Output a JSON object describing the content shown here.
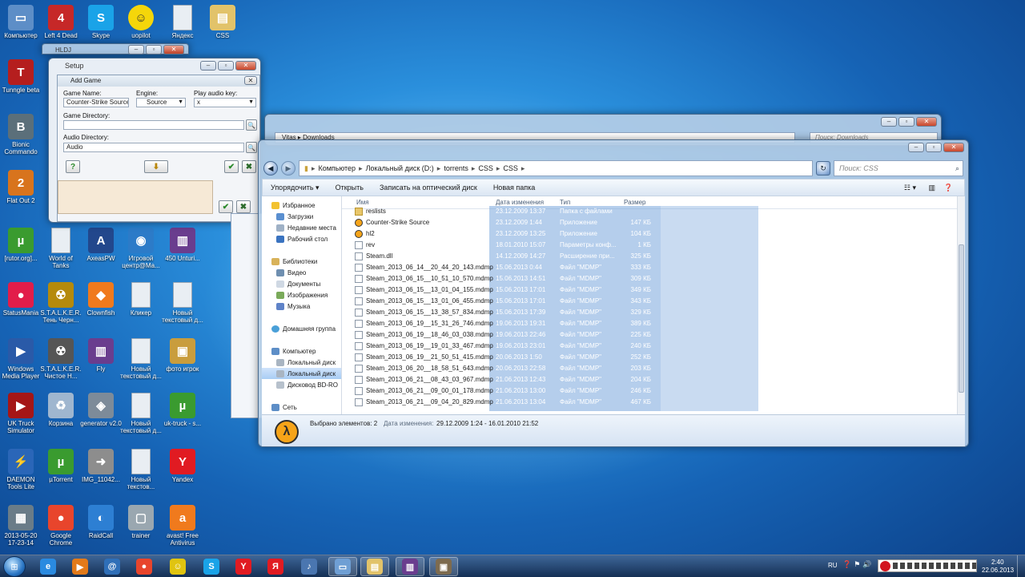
{
  "desktop": {
    "icons": [
      {
        "label": "Компьютер",
        "icon": "computer-icon",
        "color": "#5d8ec7"
      },
      {
        "label": "Left 4 Dead",
        "icon": "left4dead-icon",
        "color": "#c62828"
      },
      {
        "label": "Skype",
        "icon": "skype-icon",
        "color": "#1aa3e8"
      },
      {
        "label": "uopilot",
        "icon": "smiley-icon",
        "color": "#f5d60a"
      },
      {
        "label": "Яндекс",
        "icon": "document-icon",
        "color": "#e9eef3"
      },
      {
        "label": "CSS",
        "icon": "folder-icon",
        "color": "#e2c36a"
      },
      {
        "label": "Tunngle beta",
        "icon": "tunngle-icon",
        "color": "#b51e1e"
      },
      {
        "label": "Bionic Commando",
        "icon": "bionic-commando-icon",
        "color": "#5b6f7a"
      },
      {
        "label": "Flat Out 2",
        "icon": "flatout-icon",
        "color": "#d8741d"
      },
      {
        "label": "[rutor.org]...",
        "icon": "utorrent-icon",
        "color": "#3a9b2f"
      },
      {
        "label": "World of Tanks",
        "icon": "document-icon",
        "color": "#e9eef3"
      },
      {
        "label": "AxeasPW",
        "icon": "axeas-icon",
        "color": "#22478c"
      },
      {
        "label": "Игровой центр@Ма...",
        "icon": "game-center-icon",
        "color": "#2c7bc8"
      },
      {
        "label": "450 Unturi...",
        "icon": "winrar-icon",
        "color": "#6a3d8e"
      },
      {
        "label": "StatusMania",
        "icon": "statusmania-icon",
        "color": "#e21d4a"
      },
      {
        "label": "S.T.A.L.K.E.R. Тень Черн...",
        "icon": "stalker-icon",
        "color": "#b58a0c"
      },
      {
        "label": "Clownfish",
        "icon": "clownfish-icon",
        "color": "#f07a1d"
      },
      {
        "label": "Кликер",
        "icon": "document-icon",
        "color": "#e9eef3"
      },
      {
        "label": "Новый текстовый д...",
        "icon": "document-icon",
        "color": "#e9eef3"
      },
      {
        "label": "Windows Media Player",
        "icon": "media-player-icon",
        "color": "#2a5aa8"
      },
      {
        "label": "S.T.A.L.K.E.R. Чистое Н...",
        "icon": "stalker-icon",
        "color": "#555555"
      },
      {
        "label": "Fly",
        "icon": "winrar-icon",
        "color": "#6a3d8e"
      },
      {
        "label": "Новый текстовый д...",
        "icon": "document-icon",
        "color": "#e9eef3"
      },
      {
        "label": "фото игрок",
        "icon": "photo-folder-icon",
        "color": "#c99d3d"
      },
      {
        "label": "UK Truck Simulator",
        "icon": "truck-icon",
        "color": "#a51616"
      },
      {
        "label": "Корзина",
        "icon": "recycle-bin-icon",
        "color": "#9fb6cf"
      },
      {
        "label": "generator v2.0",
        "icon": "generator-icon",
        "color": "#7d8b99"
      },
      {
        "label": "Новый текстовый д...",
        "icon": "document-icon",
        "color": "#e9eef3"
      },
      {
        "label": "uk-truck - s...",
        "icon": "utorrent-icon",
        "color": "#3a9b2f"
      },
      {
        "label": "DAEMON Tools Lite",
        "icon": "daemon-tools-icon",
        "color": "#2a66b8"
      },
      {
        "label": "µTorrent",
        "icon": "utorrent-icon",
        "color": "#3a9b2f"
      },
      {
        "label": "IMG_11042...",
        "icon": "shortcut-arrow-icon",
        "color": "#8d8d8d"
      },
      {
        "label": "Новый текстов...",
        "icon": "document-icon",
        "color": "#e9eef3"
      },
      {
        "label": "Yandex",
        "icon": "yandex-icon",
        "color": "#e11b22"
      },
      {
        "label": "2013-05-20 17-23-14",
        "icon": "screenshot-icon",
        "color": "#6a7c88"
      },
      {
        "label": "Google Chrome",
        "icon": "chrome-icon",
        "color": "#e8452c"
      },
      {
        "label": "RaidCall",
        "icon": "raidcall-icon",
        "color": "#2d7fd3"
      },
      {
        "label": "trainer",
        "icon": "trainer-icon",
        "color": "#9aa7b0"
      },
      {
        "label": "avast! Free Antivirus",
        "icon": "avast-icon",
        "color": "#f07a1d"
      }
    ]
  },
  "hldj": {
    "title": "HLDJ",
    "setup_title": "Setup",
    "add_game_title": "Add Game",
    "game_name_label": "Game Name:",
    "game_name_value": "Counter-Strike Source",
    "engine_label": "Engine:",
    "engine_value": "Source",
    "play_key_label": "Play audio key:",
    "play_key_value": "x",
    "game_dir_label": "Game Directory:",
    "audio_dir_label": "Audio Directory:",
    "audio_dir_value": "Audio",
    "help_glyph": "?",
    "ok_glyph": "✔",
    "cancel_glyph": "✖",
    "down_glyph": "⬇"
  },
  "downloads_window": {
    "path": [
      "Vitas",
      "Downloads"
    ],
    "search_placeholder": "Поиск: Downloads"
  },
  "explorer": {
    "breadcrumbs": [
      "Компьютер",
      "Локальный диск (D:)",
      "torrents",
      "CSS",
      "CSS"
    ],
    "search_placeholder": "Поиск: CSS",
    "toolbar": [
      "Упорядочить ▾",
      "Открыть",
      "Записать на оптический диск",
      "Новая папка"
    ],
    "nav": {
      "favorites": "Избранное",
      "fav_items": [
        "Загрузки",
        "Недавние места",
        "Рабочий стол"
      ],
      "libraries": "Библиотеки",
      "lib_items": [
        "Видео",
        "Документы",
        "Изображения",
        "Музыка"
      ],
      "homegroup": "Домашняя группа",
      "computer": "Компьютер",
      "comp_items": [
        "Локальный диск",
        "Локальный диск",
        "Дисковод BD-RO"
      ],
      "network": "Сеть"
    },
    "columns": {
      "name": "Имя",
      "date": "Дата изменения",
      "type": "Тип",
      "size": "Размер"
    },
    "files": [
      {
        "name": "reslists",
        "date": "23.12.2009 13:37",
        "type": "Папка с файлами",
        "size": "",
        "kind": "folder"
      },
      {
        "name": "Counter-Strike Source",
        "date": "23.12.2009 1:44",
        "type": "Приложение",
        "size": "147 КБ",
        "kind": "app"
      },
      {
        "name": "hl2",
        "date": "23.12.2009 13:25",
        "type": "Приложение",
        "size": "104 КБ",
        "kind": "app"
      },
      {
        "name": "rev",
        "date": "18.01.2010 15:07",
        "type": "Параметры конф...",
        "size": "1 КБ",
        "kind": "file"
      },
      {
        "name": "Steam.dll",
        "date": "14.12.2009 14:27",
        "type": "Расширение при...",
        "size": "325 КБ",
        "kind": "file"
      },
      {
        "name": "Steam_2013_06_14__20_44_20_143.mdmp",
        "date": "15.06.2013 0:44",
        "type": "Файл \"MDMP\"",
        "size": "333 КБ",
        "kind": "file"
      },
      {
        "name": "Steam_2013_06_15__10_51_10_570.mdmp",
        "date": "15.06.2013 14:51",
        "type": "Файл \"MDMP\"",
        "size": "309 КБ",
        "kind": "file"
      },
      {
        "name": "Steam_2013_06_15__13_01_04_155.mdmp",
        "date": "15.06.2013 17:01",
        "type": "Файл \"MDMP\"",
        "size": "349 КБ",
        "kind": "file"
      },
      {
        "name": "Steam_2013_06_15__13_01_06_455.mdmp",
        "date": "15.06.2013 17:01",
        "type": "Файл \"MDMP\"",
        "size": "343 КБ",
        "kind": "file"
      },
      {
        "name": "Steam_2013_06_15__13_38_57_834.mdmp",
        "date": "15.06.2013 17:39",
        "type": "Файл \"MDMP\"",
        "size": "329 КБ",
        "kind": "file"
      },
      {
        "name": "Steam_2013_06_19__15_31_26_746.mdmp",
        "date": "19.06.2013 19:31",
        "type": "Файл \"MDMP\"",
        "size": "389 КБ",
        "kind": "file"
      },
      {
        "name": "Steam_2013_06_19__18_46_03_038.mdmp",
        "date": "19.06.2013 22:46",
        "type": "Файл \"MDMP\"",
        "size": "225 КБ",
        "kind": "file"
      },
      {
        "name": "Steam_2013_06_19__19_01_33_467.mdmp",
        "date": "19.06.2013 23:01",
        "type": "Файл \"MDMP\"",
        "size": "240 КБ",
        "kind": "file"
      },
      {
        "name": "Steam_2013_06_19__21_50_51_415.mdmp",
        "date": "20.06.2013 1:50",
        "type": "Файл \"MDMP\"",
        "size": "252 КБ",
        "kind": "file"
      },
      {
        "name": "Steam_2013_06_20__18_58_51_643.mdmp",
        "date": "20.06.2013 22:58",
        "type": "Файл \"MDMP\"",
        "size": "203 КБ",
        "kind": "file"
      },
      {
        "name": "Steam_2013_06_21__08_43_03_967.mdmp",
        "date": "21.06.2013 12:43",
        "type": "Файл \"MDMP\"",
        "size": "204 КБ",
        "kind": "file"
      },
      {
        "name": "Steam_2013_06_21__09_00_01_178.mdmp",
        "date": "21.06.2013 13:00",
        "type": "Файл \"MDMP\"",
        "size": "246 КБ",
        "kind": "file"
      },
      {
        "name": "Steam_2013_06_21__09_04_20_829.mdmp",
        "date": "21.06.2013 13:04",
        "type": "Файл \"MDMP\"",
        "size": "467 КБ",
        "kind": "file"
      }
    ],
    "status": {
      "selected": "Выбрано элементов: 2",
      "date_label": "Дата изменения:",
      "date_range": "29.12.2009 1:24 - 16.01.2010 21:52"
    }
  },
  "taskbar": {
    "start_icon": "start-orb-icon",
    "pinned": [
      {
        "icon": "internet-explorer-icon",
        "color": "#2a8ae0",
        "glyph": "e"
      },
      {
        "icon": "media-player-icon",
        "color": "#e27a1a",
        "glyph": "▶"
      },
      {
        "icon": "mail-icon",
        "color": "#2f6fb8",
        "glyph": "@"
      },
      {
        "icon": "chrome-icon",
        "color": "#e8452c",
        "glyph": "●"
      },
      {
        "icon": "smiley-icon",
        "color": "#e0c410",
        "glyph": "☺"
      },
      {
        "icon": "skype-icon",
        "color": "#1aa3e8",
        "glyph": "S"
      },
      {
        "icon": "yandex-browser-icon",
        "color": "#e11b22",
        "glyph": "Y"
      },
      {
        "icon": "yandex-icon",
        "color": "#e11b22",
        "glyph": "Я"
      },
      {
        "icon": "speaker-icon",
        "color": "#4a76b0",
        "glyph": "♪"
      },
      {
        "icon": "window-icon",
        "color": "#6f9fd4",
        "glyph": "▭"
      },
      {
        "icon": "explorer-folder-icon",
        "color": "#e2c36a",
        "glyph": "▤"
      },
      {
        "icon": "winrar-icon",
        "color": "#6a3d8e",
        "glyph": "▥"
      },
      {
        "icon": "hldj-icon",
        "color": "#7d6b4f",
        "glyph": "▣"
      }
    ],
    "lang": "RU",
    "time": "2:40",
    "date": "22.06.2013"
  }
}
